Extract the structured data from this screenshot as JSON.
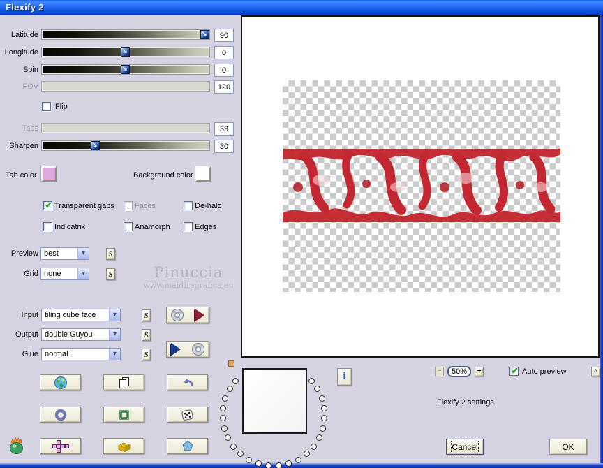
{
  "window": {
    "title": "Flexify 2"
  },
  "colors": {
    "dialog_bg": "#d5d3e2",
    "titlebar_blue": "#2269f6",
    "window_border_blue": "#1d45cd",
    "tab_color_swatch": "#dfa9df",
    "background_color_swatch": "#ffffff",
    "checkmark_green": "#18a018",
    "slider_thumb_blue": "#1f4296",
    "preview_image_red": "#c5262e"
  },
  "sliders": [
    {
      "label": "Latitude",
      "value": "90",
      "enabled": true
    },
    {
      "label": "Longitude",
      "value": "0",
      "enabled": true
    },
    {
      "label": "Spin",
      "value": "0",
      "enabled": true
    },
    {
      "label": "FOV",
      "value": "120",
      "enabled": false
    },
    {
      "label": "Tabs",
      "value": "33",
      "enabled": false
    },
    {
      "label": "Sharpen",
      "value": "30",
      "enabled": true
    }
  ],
  "flip": {
    "label": "Flip",
    "checked": false,
    "mark": ""
  },
  "color_pickers": {
    "tab_color_label": "Tab color",
    "background_color_label": "Background color"
  },
  "options": [
    {
      "label": "Transparent gaps",
      "checked": true,
      "enabled": true,
      "mark": "✔"
    },
    {
      "label": "Faces",
      "checked": false,
      "enabled": false,
      "mark": ""
    },
    {
      "label": "De-halo",
      "checked": false,
      "enabled": true,
      "mark": ""
    },
    {
      "label": "Indicatrix",
      "checked": false,
      "enabled": true,
      "mark": ""
    },
    {
      "label": "Anamorph",
      "checked": false,
      "enabled": true,
      "mark": ""
    },
    {
      "label": "Edges",
      "checked": false,
      "enabled": true,
      "mark": ""
    }
  ],
  "dropdowns": {
    "preview": {
      "label": "Preview",
      "value": "best"
    },
    "grid": {
      "label": "Grid",
      "value": "none"
    },
    "input": {
      "label": "Input",
      "value": "tiling cube face"
    },
    "output": {
      "label": "Output",
      "value": "double Guyou"
    },
    "glue": {
      "label": "Glue",
      "value": "normal"
    }
  },
  "s_button_label": "S",
  "watermark": {
    "line1": "Pinuccia",
    "line2": "www.maidiregrafica.eu"
  },
  "zoom_controls": {
    "minus": "−",
    "level": "50%",
    "plus": "+"
  },
  "auto_preview": {
    "label": "Auto preview",
    "checked": true,
    "mark": "✔"
  },
  "collapse_label": "^",
  "info_label": "i",
  "settings_label": "Flexify 2 settings",
  "buttons": {
    "cancel": "Cancel",
    "ok": "OK"
  },
  "icons": [
    "globe",
    "copy-pages",
    "undo-arrow",
    "ring",
    "green-frame",
    "dice",
    "cube-net",
    "lego-brick",
    "polyhedron",
    "flaming-pear",
    "cd",
    "play-triangle-red",
    "play-triangle-blue",
    "info",
    "chevron-down",
    "slider-thumb-arrow"
  ]
}
